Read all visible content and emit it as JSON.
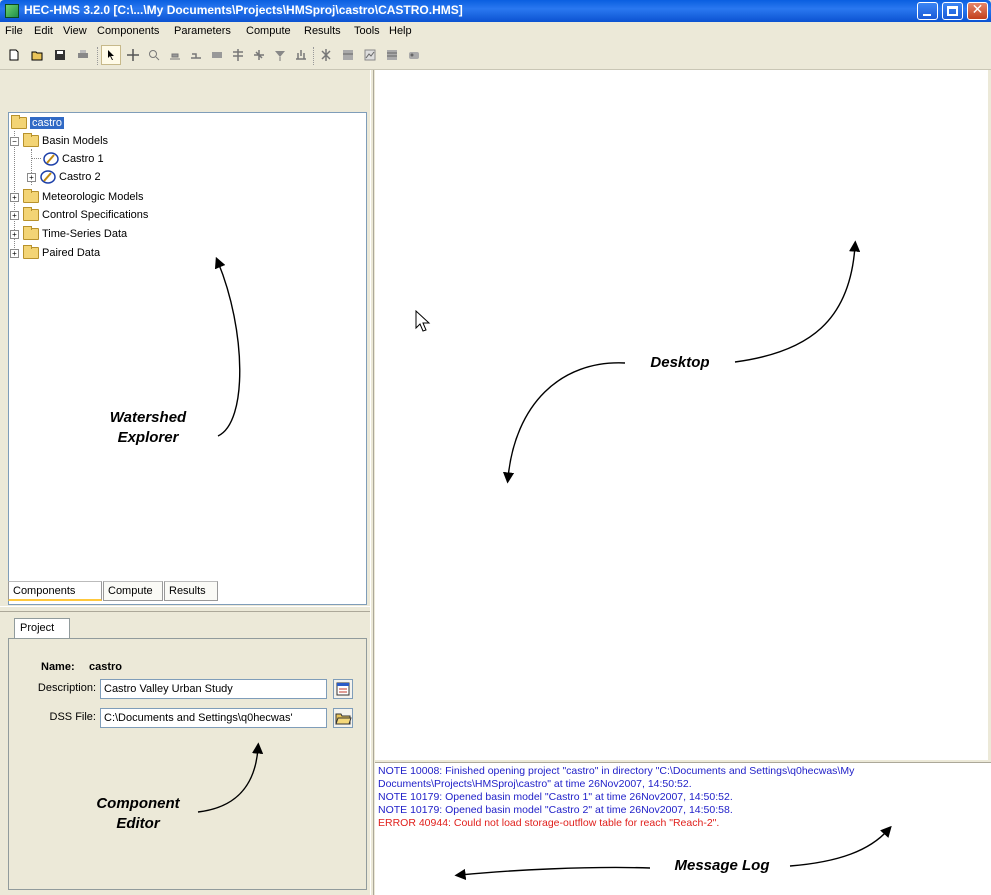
{
  "window": {
    "title": "HEC-HMS 3.2.0 [C:\\...\\My Documents\\Projects\\HMSproj\\castro\\CASTRO.HMS]"
  },
  "menu": [
    "File",
    "Edit",
    "View",
    "Components",
    "Parameters",
    "Compute",
    "Results",
    "Tools",
    "Help"
  ],
  "toolbar": {
    "icons": [
      "new-file-icon",
      "open-folder-icon",
      "save-icon",
      "print-icon",
      "arrow-select-icon",
      "move-icon",
      "zoom-icon",
      "subbasin-icon",
      "reach-icon",
      "reservoir-icon",
      "junction-icon",
      "diversion-icon",
      "source-icon",
      "sink-icon",
      "compute-icon",
      "results-table-icon",
      "graph-icon",
      "summary-table-icon",
      "time-series-icon"
    ]
  },
  "explorer": {
    "root": "castro",
    "basin_models_label": "Basin Models",
    "basin_items": [
      "Castro 1",
      "Castro 2"
    ],
    "other_folders": [
      "Meteorologic Models",
      "Control Specifications",
      "Time-Series Data",
      "Paired Data"
    ],
    "tabs": [
      "Components",
      "Compute",
      "Results"
    ],
    "selected_tab": "Components"
  },
  "editor": {
    "tab": "Project",
    "name_label": "Name:",
    "name_value": "castro",
    "description_label": "Description:",
    "description_value": "Castro Valley Urban Study",
    "dss_label": "DSS File:",
    "dss_value": "C:\\Documents and Settings\\q0hecwas'"
  },
  "message_log": [
    {
      "text": "NOTE 10008:  Finished opening project \"castro\" in directory \"C:\\Documents and Settings\\q0hecwas\\My",
      "type": "note"
    },
    {
      "text": "Documents\\Projects\\HMSproj\\castro\" at time 26Nov2007, 14:50:52.",
      "type": "note"
    },
    {
      "text": "NOTE 10179:  Opened basin model \"Castro 1\" at time 26Nov2007, 14:50:52.",
      "type": "note"
    },
    {
      "text": "NOTE 10179:  Opened basin model \"Castro 2\" at time 26Nov2007, 14:50:58.",
      "type": "note"
    },
    {
      "text": "ERROR 40944:  Could not load storage-outflow table for reach \"Reach-2\".",
      "type": "error"
    }
  ],
  "annotations": {
    "watershed_explorer_line1": "Watershed",
    "watershed_explorer_line2": "Explorer",
    "desktop": "Desktop",
    "component_editor_line1": "Component",
    "component_editor_line2": "Editor",
    "message_log": "Message Log"
  },
  "colors": {
    "note": "#1e1ec8",
    "error": "#e0201c",
    "selection": "#316ac5",
    "titlebar": "#0a5fe0"
  }
}
